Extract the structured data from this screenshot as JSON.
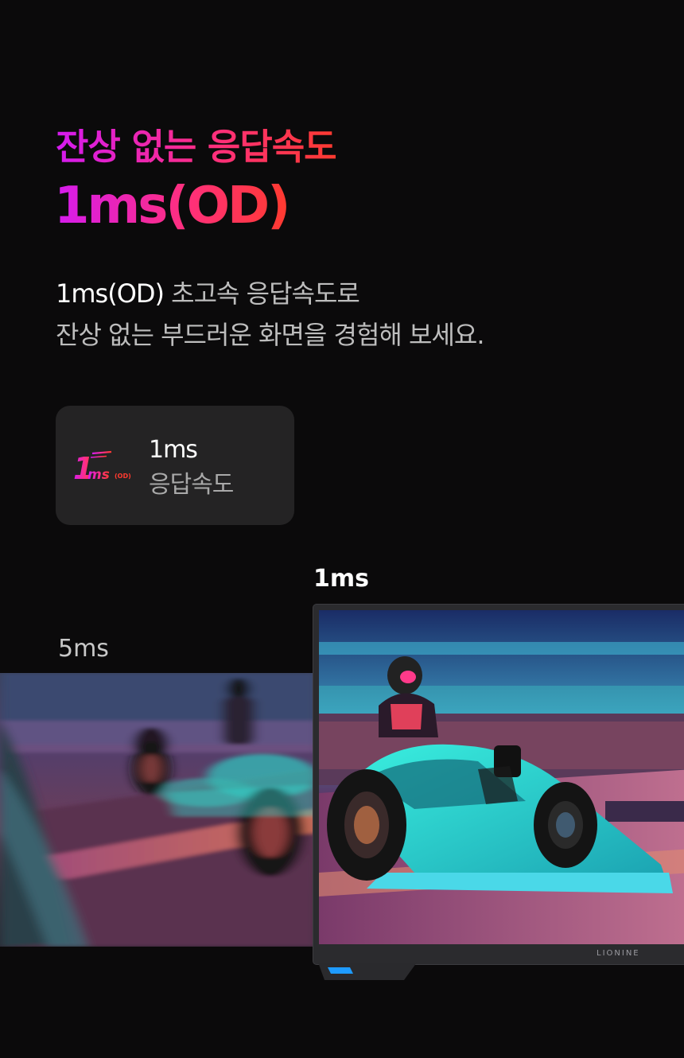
{
  "hero": {
    "title_line1": "잔상 없는 응답속도",
    "title_line2": "1ms(OD)"
  },
  "description": {
    "line1_highlight": "1ms(OD)",
    "line1_rest": " 초고속 응답속도로",
    "line2": "잔상 없는 부드러운 화면을 경험해 보세요."
  },
  "spec_card": {
    "logo_number": "1",
    "logo_unit": "ms",
    "logo_suffix": "(OD)",
    "value": "1ms",
    "label": "응답속도"
  },
  "comparison": {
    "slow_label": "5ms",
    "fast_label": "1ms",
    "monitor_brand": "LIONINE"
  },
  "colors": {
    "background": "#0b0a0b",
    "gradient_start": "#d41bf0",
    "gradient_mid": "#ff2f7f",
    "gradient_end": "#ff3a2f",
    "card_bg": "#242324",
    "monitor_accent": "#1e9bff"
  }
}
